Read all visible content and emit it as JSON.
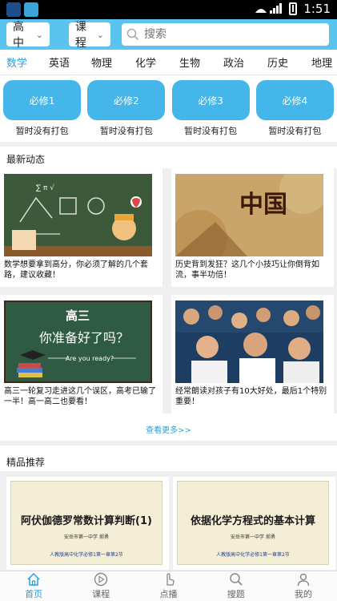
{
  "status_bar": {
    "time": "1:51"
  },
  "header": {
    "level_select": "高中",
    "type_select": "课程",
    "search_placeholder": "搜索"
  },
  "subjects": [
    "数学",
    "英语",
    "物理",
    "化学",
    "生物",
    "政治",
    "历史",
    "地理"
  ],
  "active_subject": "数学",
  "packages": [
    {
      "label": "必修1",
      "note": "暂时没有打包"
    },
    {
      "label": "必修2",
      "note": "暂时没有打包"
    },
    {
      "label": "必修3",
      "note": "暂时没有打包"
    },
    {
      "label": "必修4",
      "note": "暂时没有打包"
    }
  ],
  "news_section": {
    "title": "最新动态",
    "items": [
      {
        "caption": "数学想要拿到高分，你必须了解的几个套路，建议收藏！"
      },
      {
        "caption": "历史背到发狂？这几个小技巧让你倒背如流，事半功倍！",
        "image_text": "中国"
      },
      {
        "caption": "高三一轮复习走进这几个误区，高考已输了一半！高一高二也要看！",
        "image_text_1": "高三",
        "image_text_2": "你准备好了吗？",
        "image_text_3": "Are you ready?"
      },
      {
        "caption": "经常朗读对孩子有10大好处，最后1个特别重要！"
      }
    ],
    "more_link": "查看更多>>"
  },
  "featured_section": {
    "title": "精品推荐",
    "items": [
      {
        "title": "阿伏伽德罗常数计算判断(1)",
        "school": "安岳市第一中学 郝勇",
        "footer": "人教版高中化学必修1第一章第2节"
      },
      {
        "title": "依据化学方程式的基本计算",
        "school": "安岳市第一中学 郝勇",
        "footer": "人教版高中化学必修1第一章第2节"
      }
    ]
  },
  "bottom_nav": [
    {
      "label": "首页",
      "icon": "home-icon"
    },
    {
      "label": "课程",
      "icon": "play-icon"
    },
    {
      "label": "点播",
      "icon": "tap-icon"
    },
    {
      "label": "搜题",
      "icon": "search-icon"
    },
    {
      "label": "我的",
      "icon": "user-icon"
    }
  ],
  "colors": {
    "accent": "#5bc3ef",
    "package_button": "#45b6ea",
    "active_text": "#2d9ed8"
  }
}
